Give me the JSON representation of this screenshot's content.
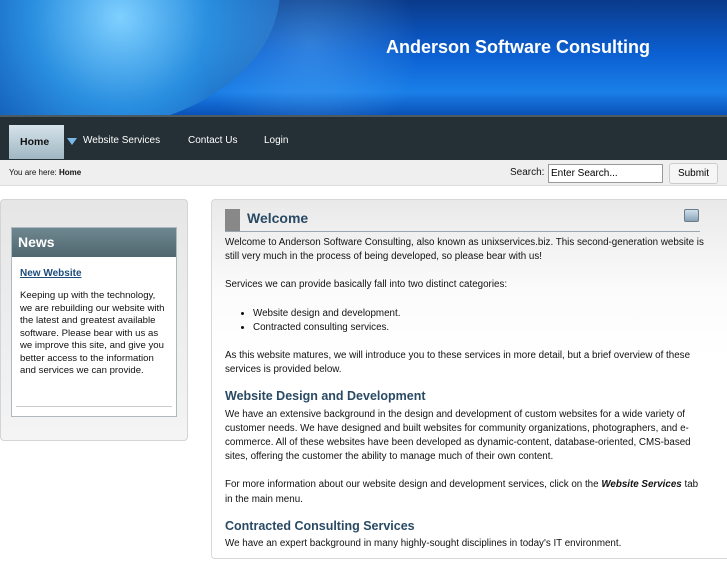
{
  "header": {
    "title": "Anderson Software Consulting"
  },
  "nav": {
    "items": [
      "Home",
      "Website Services",
      "Contact Us",
      "Login"
    ]
  },
  "breadcrumb": {
    "prefix": "You are here:",
    "current": "Home"
  },
  "search": {
    "label": "Search:",
    "placeholder": "Enter Search...",
    "submit": "Submit"
  },
  "news": {
    "title": "News",
    "link": "New Website",
    "text": "Keeping up with the technology, we are rebuilding our website with the latest and greatest available software. Please bear with us as we improve this site, and give you better access to the information and services we can provide."
  },
  "main": {
    "title": "Welcome",
    "p1": "Welcome to Anderson Software Consulting, also known as unixservices.biz. This second-generation website is still very much in the process of being developed, so please bear with us!",
    "p2": "Services we can provide basically fall into two distinct categories:",
    "list": [
      "Website design and development.",
      "Contracted consulting services."
    ],
    "p3": "As this website matures, we will introduce you to these services in more detail, but a brief overview of these services is provided below.",
    "h1": "Website Design and Development",
    "p4": "We have an extensive background in the design and development of custom websites for a wide variety of customer needs. We have designed and built websites for community organizations, photographers, and e-commerce. All of these websites have been developed as dynamic-content, database-oriented, CMS-based sites, offering the customer the ability to manage much of their own content.",
    "p5a": "For more information about our website design and development services, click on the",
    "p5b": "Website Services",
    "p5c": "tab in the main menu.",
    "h2": "Contracted Consulting Services",
    "p6": "We have an expert background in many highly-sought disciplines in today's IT environment."
  }
}
